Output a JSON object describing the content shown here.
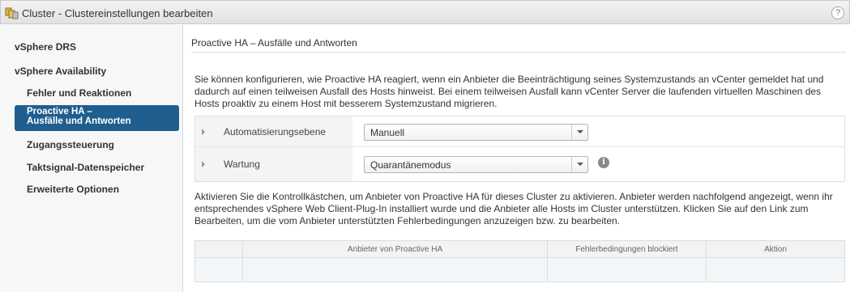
{
  "window": {
    "title": "Cluster - Clustereinstellungen bearbeiten",
    "help_label": "?",
    "title_icon": "cluster-icon"
  },
  "sidebar": {
    "items": [
      {
        "label": "vSphere DRS"
      },
      {
        "label": "vSphere Availability"
      },
      {
        "label": "Fehler und Reaktionen"
      },
      {
        "label_line1": "Proactive HA –",
        "label_line2": "Ausfälle und Antworten",
        "selected": true
      },
      {
        "label": "Zugangssteuerung"
      },
      {
        "label": "Taktsignal-Datenspeicher"
      },
      {
        "label": "Erweiterte Optionen"
      }
    ]
  },
  "main": {
    "section_title": "Proactive HA – Ausfälle und Antworten",
    "description": "Sie können konfigurieren, wie Proactive HA reagiert, wenn ein Anbieter die Beeinträchtigung seines Systemzustands an vCenter gemeldet hat und dadurch auf einen teilweisen Ausfall des Hosts hinweist. Bei einem teilweisen Ausfall kann vCenter Server die laufenden virtuellen Maschinen des Hosts proaktiv zu einem Host mit besserem Systemzustand migrieren.",
    "settings": [
      {
        "label": "Automatisierungsebene",
        "value": "Manuell"
      },
      {
        "label": "Wartung",
        "value": "Quarantänemodus",
        "info_icon": "info-icon"
      }
    ],
    "instructions": "Aktivieren Sie die Kontrollkästchen, um Anbieter von Proactive HA für dieses Cluster zu aktivieren. Anbieter werden nachfolgend angezeigt, wenn ihr entsprechendes vSphere Web Client-Plug-In installiert wurde und die Anbieter alle Hosts im Cluster unterstützen. Klicken Sie auf den Link zum Bearbeiten, um die vom Anbieter unterstützten Fehlerbedingungen anzuzeigen bzw. zu bearbeiten.",
    "table": {
      "columns": [
        "",
        "Anbieter von Proactive HA",
        "Fehlerbedingungen blockiert",
        "Aktion"
      ],
      "rows": []
    }
  },
  "colors": {
    "selected_nav_bg": "#1f5e8e",
    "info_icon": "#888888"
  }
}
